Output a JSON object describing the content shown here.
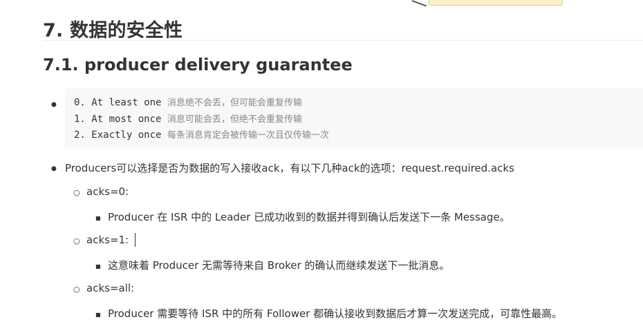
{
  "heading1": "7. 数据的安全性",
  "heading2": "7.1. producer delivery guarantee",
  "code_lines": [
    {
      "code": "0. At least one ",
      "comment": "消息绝不会丢，但可能会重复传输"
    },
    {
      "code": "1. At most once ",
      "comment": "消息可能会丢，但绝不会重复传输"
    },
    {
      "code": "2. Exactly once ",
      "comment": "每条消息肯定会被传输一次且仅传输一次"
    }
  ],
  "producers_text": "Producers可以选择是否为数据的写入接收ack，有以下几种ack的选项：request.required.acks",
  "acks": [
    {
      "label": "acks=0:",
      "detail": "Producer 在 ISR 中的 Leader 已成功收到的数据并得到确认后发送下一条 Message。"
    },
    {
      "label": "acks=1:",
      "detail": "这意味着 Producer 无需等待来自 Broker 的确认而继续发送下一批消息。"
    },
    {
      "label": "acks=all:",
      "detail": "Producer 需要等待 ISR 中的所有 Follower 都确认接收到数据后才算一次发送完成，可靠性最高。"
    }
  ]
}
